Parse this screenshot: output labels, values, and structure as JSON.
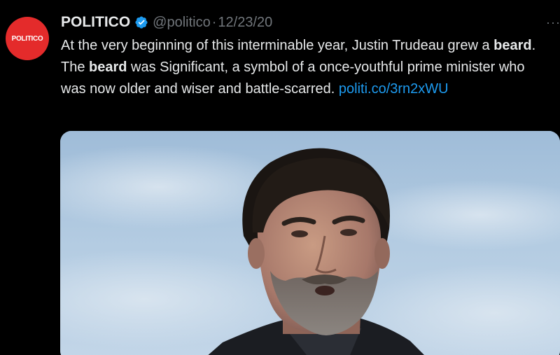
{
  "tweet": {
    "avatar_text": "POLITICO",
    "display_name": "POLITICO",
    "handle": "@politico",
    "separator": "·",
    "date": "12/23/20",
    "more_label": "···",
    "text_segments": [
      {
        "text": "At the very beginning of this interminable year, Justin Trudeau grew a ",
        "style": "normal"
      },
      {
        "text": "beard",
        "style": "bold"
      },
      {
        "text": ". The ",
        "style": "normal"
      },
      {
        "text": "beard",
        "style": "bold"
      },
      {
        "text": " was Significant, a symbol of a once-youthful prime minister who was now older and wiser and battle-scarred. ",
        "style": "normal"
      },
      {
        "text": "politi.co/3rn2xWU",
        "style": "link"
      }
    ]
  },
  "colors": {
    "background": "#000000",
    "primary_text": "#e7e9ea",
    "secondary_text": "#71767b",
    "link": "#1d9bf0",
    "avatar_bg": "#e42b2b",
    "verified_badge": "#1d9bf0"
  },
  "icons": {
    "verified": "verified-badge-icon",
    "more": "more-options-icon"
  }
}
